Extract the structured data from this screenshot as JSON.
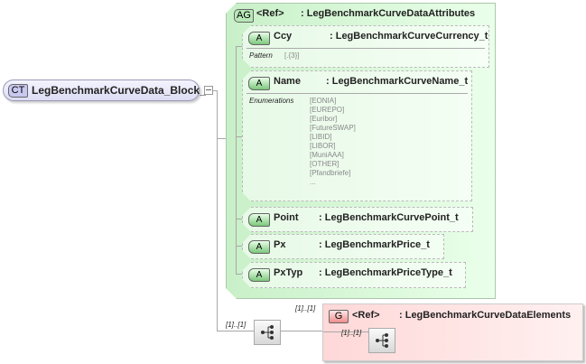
{
  "complex_type": {
    "badge": "CT",
    "name": "LegBenchmarkCurveData_Block_t"
  },
  "attribute_group": {
    "badge": "AG",
    "ref": "<Ref>",
    "type": ": LegBenchmarkCurveDataAttributes"
  },
  "attributes": [
    {
      "badge": "A",
      "name": "Ccy",
      "type": ": LegBenchmarkCurveCurrency_t",
      "facet_label": "Pattern",
      "facet_values": [
        "[.{3}]"
      ]
    },
    {
      "badge": "A",
      "name": "Name",
      "type": ": LegBenchmarkCurveName_t",
      "facet_label": "Enumerations",
      "facet_values": [
        "[EONIA]",
        "[EUREPO]",
        "[Euribor]",
        "[FutureSWAP]",
        "[LIBID]",
        "[LIBOR]",
        "[MuniAAA]",
        "[OTHER]",
        "[Pfandbriefe]",
        "..."
      ]
    },
    {
      "badge": "A",
      "name": "Point",
      "type": ": LegBenchmarkCurvePoint_t"
    },
    {
      "badge": "A",
      "name": "Px",
      "type": ": LegBenchmarkPrice_t"
    },
    {
      "badge": "A",
      "name": "PxTyp",
      "type": ": LegBenchmarkPriceType_t"
    }
  ],
  "sequence": {
    "multiplicity": "[1]..[1]"
  },
  "group": {
    "badge": "G",
    "ref": "<Ref>",
    "type": ": LegBenchmarkCurveDataElements",
    "multiplicity": "[1]..[1]",
    "inner_multiplicity": "[1]..[1]"
  }
}
